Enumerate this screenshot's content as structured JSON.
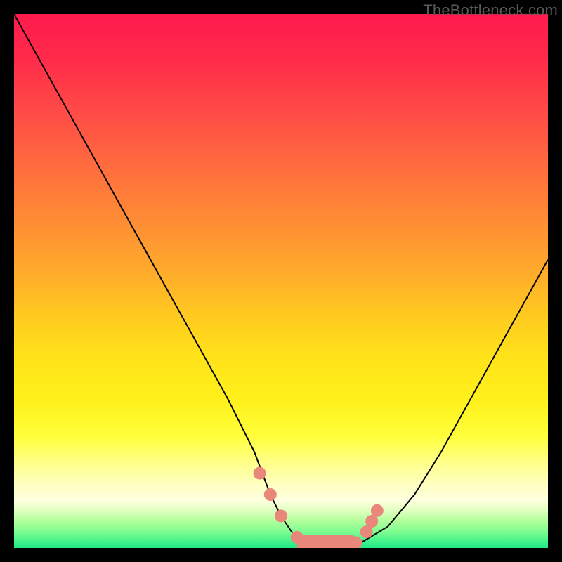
{
  "watermark": {
    "text": "TheBottleneck.com"
  },
  "chart_data": {
    "type": "line",
    "title": "",
    "xlabel": "",
    "ylabel": "",
    "xlim": [
      0,
      100
    ],
    "ylim": [
      0,
      100
    ],
    "series": [
      {
        "name": "bottleneck-curve",
        "x": [
          0,
          5,
          10,
          15,
          20,
          25,
          30,
          35,
          40,
          45,
          48,
          50,
          52,
          55,
          58,
          60,
          62,
          65,
          70,
          75,
          80,
          85,
          90,
          95,
          100
        ],
        "y": [
          100,
          91,
          82,
          73,
          64,
          55,
          46,
          37,
          28,
          18,
          10,
          6,
          3,
          1,
          0,
          0,
          0,
          1,
          4,
          10,
          18,
          27,
          36,
          45,
          54
        ]
      }
    ],
    "markers": [
      {
        "name": "left-shoulder-1",
        "x": 46,
        "y": 14
      },
      {
        "name": "left-shoulder-2",
        "x": 48,
        "y": 10
      },
      {
        "name": "left-shoulder-3",
        "x": 50,
        "y": 6
      },
      {
        "name": "trough-1",
        "x": 53,
        "y": 2
      },
      {
        "name": "trough-2",
        "x": 55,
        "y": 1
      },
      {
        "name": "trough-3",
        "x": 58,
        "y": 0
      },
      {
        "name": "trough-4",
        "x": 61,
        "y": 0
      },
      {
        "name": "right-shoulder-1",
        "x": 64,
        "y": 1
      },
      {
        "name": "right-shoulder-2",
        "x": 66,
        "y": 3
      },
      {
        "name": "right-shoulder-3",
        "x": 67,
        "y": 5
      },
      {
        "name": "right-shoulder-4",
        "x": 68,
        "y": 7
      }
    ],
    "marker_color": "#e9877b",
    "marker_radius": 9,
    "trough_bar": {
      "x1": 53,
      "x2": 64,
      "y": 0.5,
      "height": 3,
      "color": "#e9877b"
    },
    "line_color": "#000000",
    "line_width": 2,
    "background_gradient": [
      {
        "stop": 0,
        "color": "#ff1a4d"
      },
      {
        "stop": 50,
        "color": "#ffaa2c"
      },
      {
        "stop": 80,
        "color": "#ffff3a"
      },
      {
        "stop": 100,
        "color": "#20e886"
      }
    ]
  }
}
